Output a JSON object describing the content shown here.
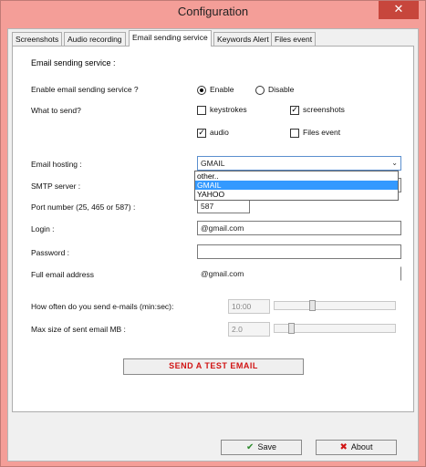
{
  "window": {
    "title": "Configuration",
    "close_glyph": "✕"
  },
  "tabs": [
    {
      "label": "Screenshots",
      "active": false
    },
    {
      "label": "Audio recording",
      "active": false
    },
    {
      "label": "Email sending service",
      "active": true
    },
    {
      "label": "Keywords Alert",
      "active": false
    },
    {
      "label": "Files event",
      "active": false
    }
  ],
  "form": {
    "heading": "Email sending service :",
    "enable_label": "Enable email sending service ?",
    "enable_option": "Enable",
    "disable_option": "Disable",
    "enable_selected": "Enable",
    "what_label": "What to send?",
    "checks": {
      "keystrokes": {
        "label": "keystrokes",
        "checked": false
      },
      "screenshots": {
        "label": "screenshots",
        "checked": true
      },
      "audio": {
        "label": "audio",
        "checked": true
      },
      "files_event": {
        "label": "Files event",
        "checked": false
      }
    },
    "hosting_label": "Email hosting :",
    "hosting_value": "GMAIL",
    "hosting_options": [
      "other..",
      "GMAIL",
      "YAHOO"
    ],
    "hosting_selected_option": "GMAIL",
    "smtp_label": "SMTP server :",
    "port_label": "Port number (25, 465 or 587) :",
    "port_value": "587",
    "login_label": "Login :",
    "login_value": "@gmail.com",
    "password_label": "Password :",
    "password_value": "",
    "address_label": "Full email address",
    "address_value": "@gmail.com",
    "freq_label": "How often do you send e-mails (min:sec):",
    "freq_value": "10:00",
    "freq_level": 0.3,
    "size_label": "Max size of sent email MB :",
    "size_value": "2.0",
    "size_level": 0.12,
    "test_button": "SEND A TEST EMAIL"
  },
  "footer": {
    "save_label": "Save",
    "save_icon": "check-icon",
    "about_label": "About",
    "about_icon": "x-icon"
  },
  "colors": {
    "titlebar": "#f49e98",
    "close_button": "#c7463c",
    "selection": "#3399ff",
    "test_button_text": "#d11414"
  }
}
